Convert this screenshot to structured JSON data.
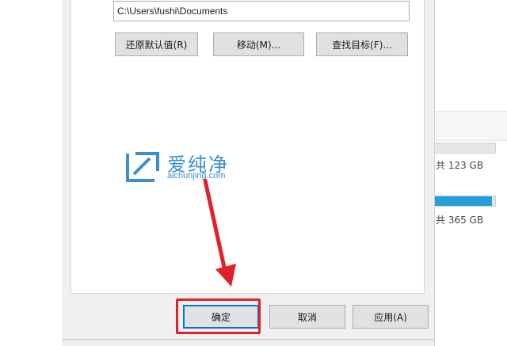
{
  "dialog": {
    "location_path": "C:\\Users\\fushi\\Documents",
    "buttons": {
      "restore_default": "还原默认值(R)",
      "move": "移动(M)...",
      "find_target": "查找目标(F)...",
      "ok": "确定",
      "cancel": "取消",
      "apply": "应用(A)"
    }
  },
  "background": {
    "drives": [
      {
        "text": "共 123 GB",
        "used_fraction": null
      },
      {
        "text": "共 365 GB",
        "used_fraction": 0.95
      }
    ]
  },
  "watermark": {
    "title": "爱纯净",
    "url": "aichunjing.com"
  },
  "annotation": {
    "color": "#e0202a",
    "icon": "red-arrow-icon"
  }
}
